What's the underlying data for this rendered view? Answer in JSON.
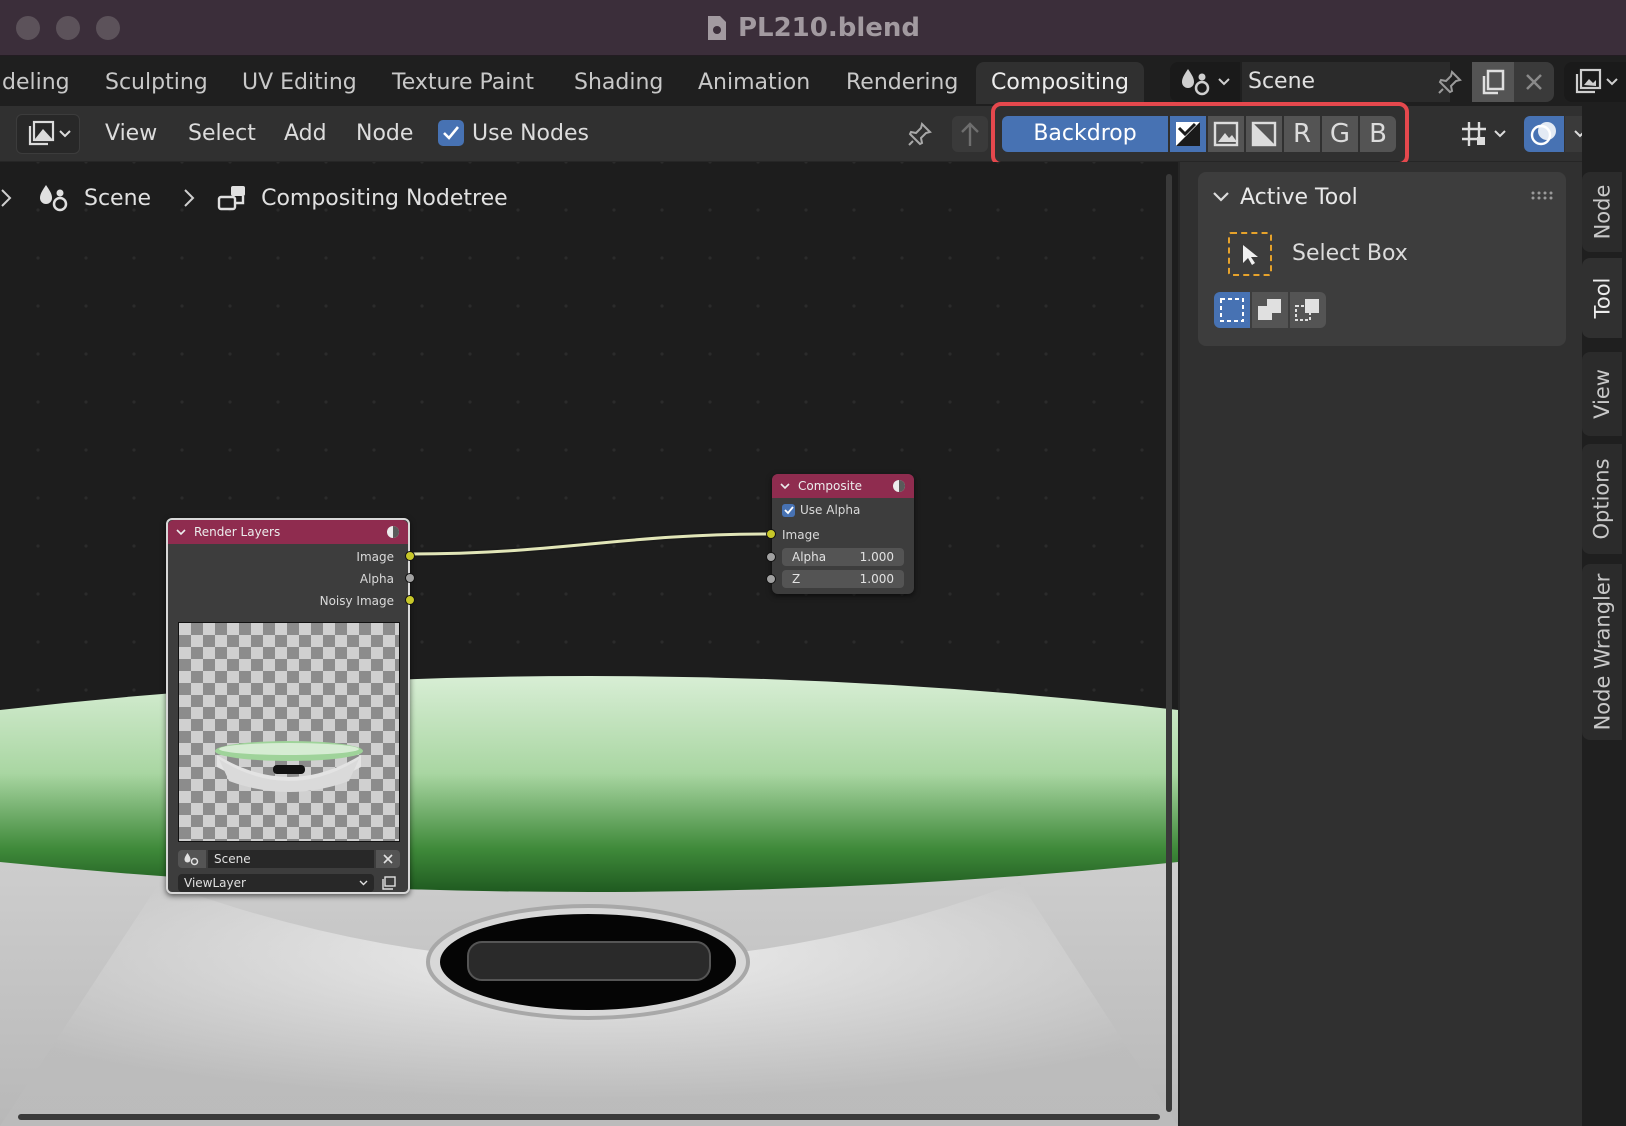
{
  "window": {
    "title": "PL210.blend"
  },
  "workspace_tabs": [
    "deling",
    "Sculpting",
    "UV Editing",
    "Texture Paint",
    "Shading",
    "Animation",
    "Rendering",
    "Compositing"
  ],
  "active_workspace": "Compositing",
  "scene_selector": {
    "value": "Scene"
  },
  "header": {
    "menus": [
      "View",
      "Select",
      "Add",
      "Node"
    ],
    "use_nodes": {
      "label": "Use Nodes",
      "checked": true
    },
    "backdrop": {
      "label": "Backdrop",
      "channels": [
        "R",
        "G",
        "B"
      ]
    }
  },
  "breadcrumb": {
    "scene": "Scene",
    "nodetree": "Compositing Nodetree"
  },
  "nodes": {
    "render_layers": {
      "title": "Render Layers",
      "outputs": [
        "Image",
        "Alpha",
        "Noisy Image"
      ],
      "scene": "Scene",
      "view_layer": "ViewLayer"
    },
    "composite": {
      "title": "Composite",
      "use_alpha": {
        "label": "Use Alpha",
        "checked": true
      },
      "input_image": "Image",
      "alpha": {
        "label": "Alpha",
        "value": "1.000"
      },
      "z": {
        "label": "Z",
        "value": "1.000"
      }
    }
  },
  "sidebar": {
    "panel_title": "Active Tool",
    "tool_name": "Select Box",
    "tabs": [
      "Node",
      "Tool",
      "View",
      "Options",
      "Node Wrangler"
    ],
    "active_tab": "Tool"
  },
  "colors": {
    "accent": "#4772b3",
    "highlight": "#e5484d",
    "node_header": "#8f2c4f",
    "socket_yellow": "#c7c729",
    "socket_gray": "#a1a1a1"
  }
}
